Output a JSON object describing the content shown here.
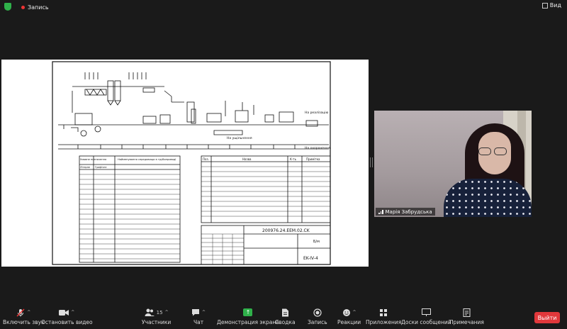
{
  "topbar": {
    "record_label": "Запись",
    "view_label": "Вид"
  },
  "drawing": {
    "label_to_cooling": "На ущільнення",
    "label_to_realization": "На реалізацію",
    "label_to_waste": "На охоронення",
    "table_title_col1": "Умовне позначення",
    "table_title_col2": "Найменування середовища в трубопроводі",
    "col_graphic": "Графічне",
    "col_number": "Літерне",
    "spec_headers": [
      "Поз.",
      "Назва",
      "К-ть",
      "Примітка"
    ],
    "stamp_code": "200976.24.EEM.02.CK",
    "stamp_sheet_code": "EK-IV-4",
    "stamp_scale": "Б/м"
  },
  "video": {
    "participant_name": "Марія Забрудська"
  },
  "toolbar": {
    "mute_label": "Включить звук",
    "video_label": "Остановить видео",
    "participants_label": "Участники",
    "participants_count": "15",
    "chat_label": "Чат",
    "share_label": "Демонстрация экрана",
    "summary_label": "Сводка",
    "record_label": "Запись",
    "reactions_label": "Реакции",
    "apps_label": "Приложения",
    "whiteboard_label": "Доски сообщений",
    "notes_label": "Примечания",
    "leave_label": "Выйти"
  }
}
